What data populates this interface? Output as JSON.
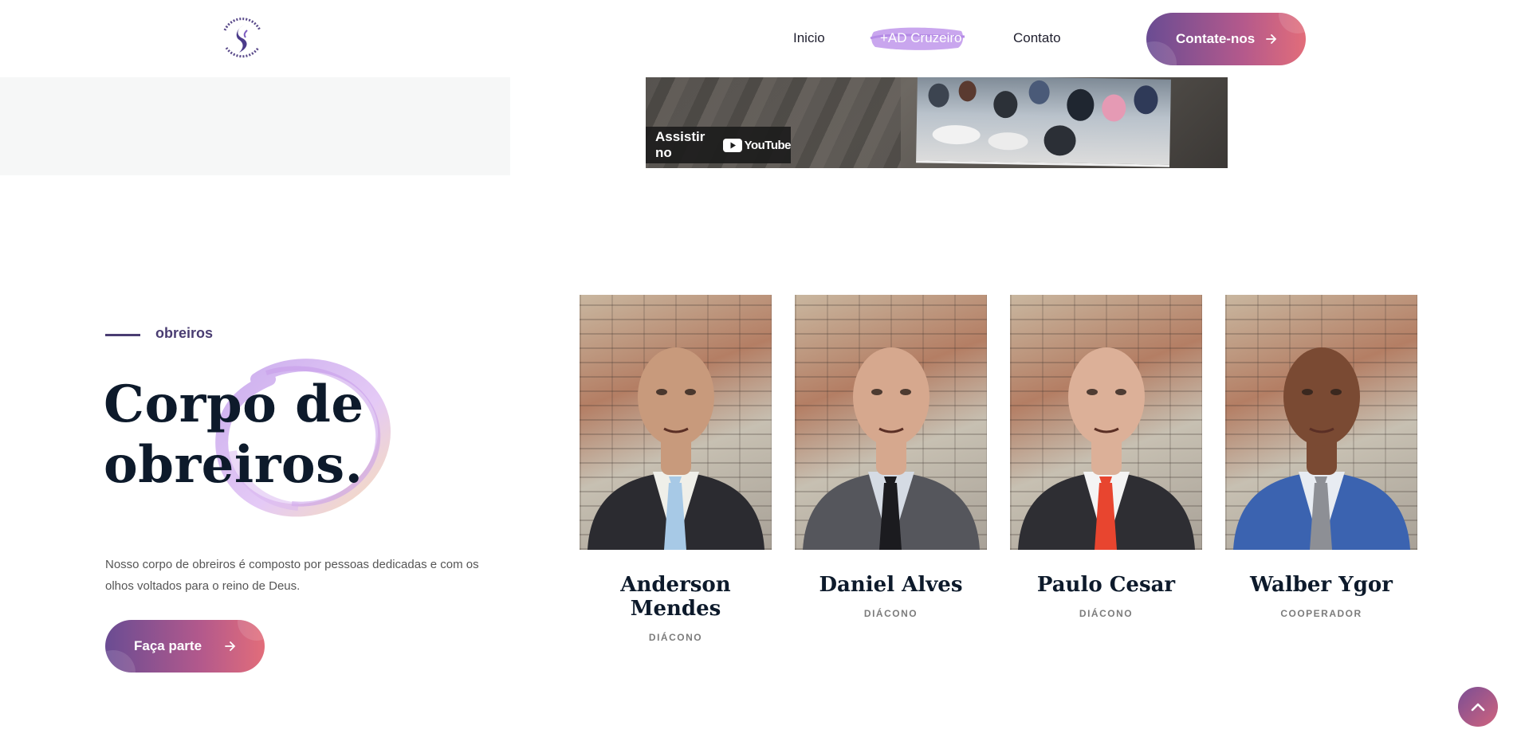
{
  "header": {
    "logo_alt": "ASSEMBLEIA DE DEUS • JARDIM CRUZEIRO",
    "nav": [
      {
        "label": "Inicio"
      },
      {
        "label": "+AD Cruzeiro"
      },
      {
        "label": "Contato"
      }
    ],
    "cta_label": "Contate-nos"
  },
  "video": {
    "watch_label": "Assistir no",
    "platform_label": "YouTube"
  },
  "intro": {
    "eyebrow": "obreiros",
    "heading_line1": "Corpo de",
    "heading_line2": "obreiros.",
    "description": "Nosso corpo de obreiros é composto por pessoas dedicadas e com os olhos voltados para o reino de Deus.",
    "button_label": "Faça parte"
  },
  "team": [
    {
      "name": "Anderson Mendes",
      "role": "DIÁCONO",
      "tie_color": "#a7c9e6",
      "suit_color": "#2b2b30",
      "shirt_color": "#efefe9",
      "skin": "#c89a7c"
    },
    {
      "name": "Daniel Alves",
      "role": "DIÁCONO",
      "tie_color": "#1b1b1f",
      "suit_color": "#55565c",
      "shirt_color": "#d5dbe4",
      "skin": "#d6a88e"
    },
    {
      "name": "Paulo Cesar",
      "role": "DIÁCONO",
      "tie_color": "#e8452f",
      "suit_color": "#2e2e33",
      "shirt_color": "#f4f4f4",
      "skin": "#dcb098"
    },
    {
      "name": "Walber Ygor",
      "role": "COOPERADOR",
      "tie_color": "#8d8f95",
      "suit_color": "#3b63b0",
      "shirt_color": "#e8ecf2",
      "skin": "#7a4a33"
    }
  ],
  "colors": {
    "accent_start": "#6a4c93",
    "accent_end": "#e26d7a",
    "heading": "#0d1a2b"
  }
}
